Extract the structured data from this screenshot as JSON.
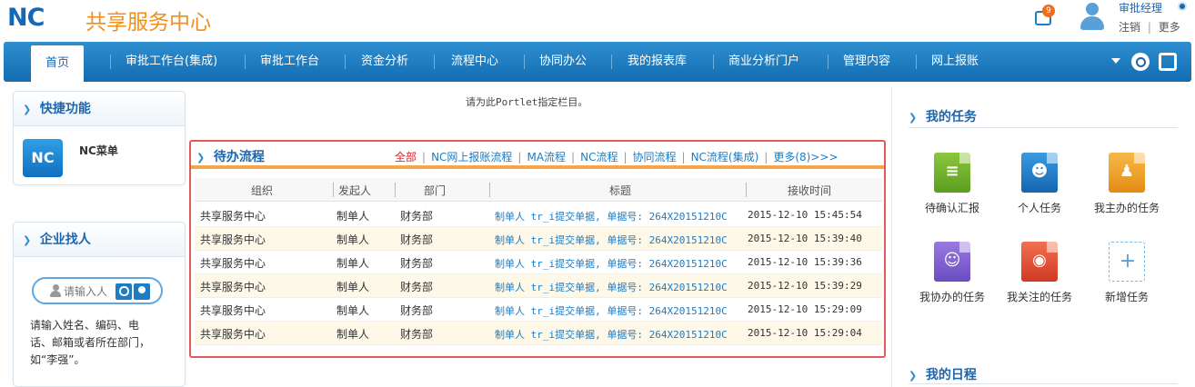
{
  "header": {
    "logo_mark": "NC",
    "logo_title": "共享服务中心",
    "message_count": "9",
    "user_name": "审批经理",
    "logout_label": "注销",
    "more_label": "更多",
    "link_separator": "|"
  },
  "nav": {
    "tabs": [
      {
        "label": "首页"
      },
      {
        "label": "审批工作台(集成)"
      },
      {
        "label": "审批工作台"
      },
      {
        "label": "资金分析"
      },
      {
        "label": "流程中心"
      },
      {
        "label": "协同办公"
      },
      {
        "label": "我的报表库"
      },
      {
        "label": "商业分析门户"
      },
      {
        "label": "管理内容"
      },
      {
        "label": "网上报账"
      }
    ]
  },
  "quick_functions": {
    "title": "快捷功能",
    "tile_label": "NC",
    "nc_menu_label": "NC菜单"
  },
  "find_person": {
    "title": "企业找人",
    "placeholder": "请输入人",
    "hint": "请输入姓名、编码、电话、邮箱或者所在部门，如“李强”。"
  },
  "center": {
    "portlet_tip": "请为此Portlet指定栏目。"
  },
  "todo": {
    "title": "待办流程",
    "filters": [
      {
        "label": "全部",
        "active": true
      },
      {
        "label": "NC网上报账流程",
        "active": false
      },
      {
        "label": "MA流程",
        "active": false
      },
      {
        "label": "NC流程",
        "active": false
      },
      {
        "label": "协同流程",
        "active": false
      },
      {
        "label": "NC流程(集成)",
        "active": false
      },
      {
        "label": "更多(8)>>>",
        "active": false
      }
    ],
    "filter_separator": "|",
    "columns": [
      "组织",
      "发起人",
      "部门",
      "标题",
      "接收时间"
    ],
    "rows": [
      {
        "org": "共享服务中心",
        "initiator": "制单人",
        "dept": "财务部",
        "title": "制单人 tr_i提交单据, 单据号: 264X20151210C",
        "time": "2015-12-10 15:45:54"
      },
      {
        "org": "共享服务中心",
        "initiator": "制单人",
        "dept": "财务部",
        "title": "制单人 tr_i提交单据, 单据号: 264X20151210C",
        "time": "2015-12-10 15:39:40"
      },
      {
        "org": "共享服务中心",
        "initiator": "制单人",
        "dept": "财务部",
        "title": "制单人 tr_i提交单据, 单据号: 264X20151210C",
        "time": "2015-12-10 15:39:36"
      },
      {
        "org": "共享服务中心",
        "initiator": "制单人",
        "dept": "财务部",
        "title": "制单人 tr_i提交单据, 单据号: 264X20151210C",
        "time": "2015-12-10 15:39:29"
      },
      {
        "org": "共享服务中心",
        "initiator": "制单人",
        "dept": "财务部",
        "title": "制单人 tr_i提交单据, 单据号: 264X20151210C",
        "time": "2015-12-10 15:29:09"
      },
      {
        "org": "共享服务中心",
        "initiator": "制单人",
        "dept": "财务部",
        "title": "制单人 tr_i提交单据, 单据号: 264X20151210C",
        "time": "2015-12-10 15:29:04"
      }
    ]
  },
  "my_tasks": {
    "title": "我的任务",
    "items": [
      {
        "label": "待确认汇报",
        "icon": "report-confirm-icon",
        "color": "#6aae2a"
      },
      {
        "label": "个人任务",
        "icon": "personal-task-icon",
        "color": "#1c7cc4"
      },
      {
        "label": "我主办的任务",
        "icon": "hosted-task-icon",
        "color": "#e89a20"
      },
      {
        "label": "我协办的任务",
        "icon": "assisted-task-icon",
        "color": "#7a5ad0"
      },
      {
        "label": "我关注的任务",
        "icon": "watched-task-icon",
        "color": "#e04a30"
      },
      {
        "label": "新增任务",
        "icon": "add-task-icon",
        "color": "#5aa0d8"
      }
    ]
  },
  "my_schedule": {
    "title": "我的日程"
  },
  "colors": {
    "brand_blue": "#1c66b0",
    "brand_orange": "#f18e1c",
    "todo_border": "#e05a5a",
    "active_filter": "#e02020"
  }
}
